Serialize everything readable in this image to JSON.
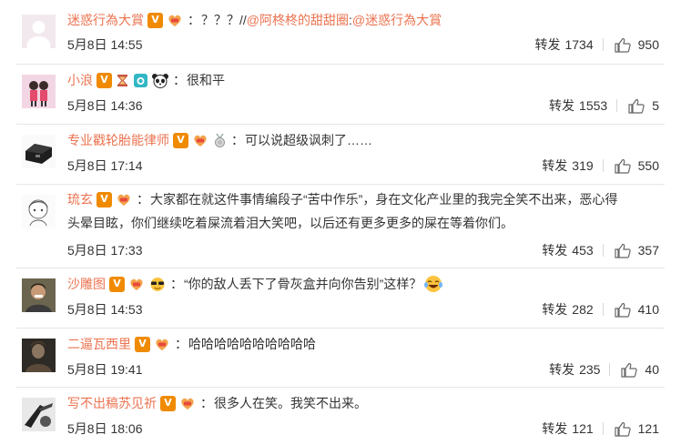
{
  "comments": [
    {
      "username": "迷惑行為大賞",
      "badges": [
        "v-badge",
        "fan-badge"
      ],
      "colon": "：",
      "text": "？？？//",
      "mention1": "@阿柊柊的甜甜圈",
      "mention_sep": ":",
      "mention2": "@迷惑行為大賞",
      "date": "5月8日 14:55",
      "forward_label": "转发",
      "forward_count": "1734",
      "like_count": "950",
      "avatar": "default-avatar-icon"
    },
    {
      "username": "小浪",
      "badges": [
        "v-badge",
        "hourglass-badge",
        "camera-badge",
        "panda-badge"
      ],
      "colon": "：",
      "text": "很和平",
      "date": "5月8日 14:36",
      "forward_label": "转发",
      "forward_count": "1553",
      "like_count": "5",
      "avatar": "couple-avatar-icon"
    },
    {
      "username": "专业戳轮胎能律师",
      "badges": [
        "v-badge",
        "fan-badge",
        "medal-badge"
      ],
      "colon": "：",
      "text": "可以说超级讽刺了……",
      "date": "5月8日 17:14",
      "forward_label": "转发",
      "forward_count": "319",
      "like_count": "550",
      "avatar": "device-avatar-icon"
    },
    {
      "username": "琉玄",
      "badges": [
        "v-badge",
        "fan-badge"
      ],
      "colon": "：",
      "text_line1": "大家都在就这件事情编段子“苦中作乐”，身在文化产业里的我完全笑不出来，恶心得",
      "text_line2": "头晕目眩，你们继续吃着屎流着泪大笑吧，以后还有更多更多的屎在等着你们。",
      "date": "5月8日 17:33",
      "forward_label": "转发",
      "forward_count": "453",
      "like_count": "357",
      "avatar": "sketch-avatar-icon"
    },
    {
      "username": "沙雕图",
      "badges": [
        "v-badge",
        "fan-badge",
        "sunglasses-emoji"
      ],
      "colon": "：",
      "text": "“你的敌人丢下了骨灰盒并向你告别”这样？",
      "emoji": "laugh-cry-emoji",
      "date": "5月8日 14:53",
      "forward_label": "转发",
      "forward_count": "282",
      "like_count": "410",
      "avatar": "man-avatar-icon"
    },
    {
      "username": "二逼瓦西里",
      "badges": [
        "v-badge",
        "fan-badge"
      ],
      "colon": "：",
      "text": "哈哈哈哈哈哈哈哈哈哈",
      "date": "5月8日 19:41",
      "forward_label": "转发",
      "forward_count": "235",
      "like_count": "40",
      "avatar": "dark-avatar-icon"
    },
    {
      "username": "写不出稿苏见祈",
      "badges": [
        "v-badge",
        "fan-badge"
      ],
      "colon": "：",
      "text": "很多人在笑。我笑不出来。",
      "date": "5月8日 18:06",
      "forward_label": "转发",
      "forward_count": "121",
      "like_count": "121",
      "avatar": "bw-avatar-icon"
    }
  ],
  "colors": {
    "username": "#eb7350",
    "text": "#333333",
    "divider": "#e6e6e6",
    "v_badge": "#f08a00"
  }
}
